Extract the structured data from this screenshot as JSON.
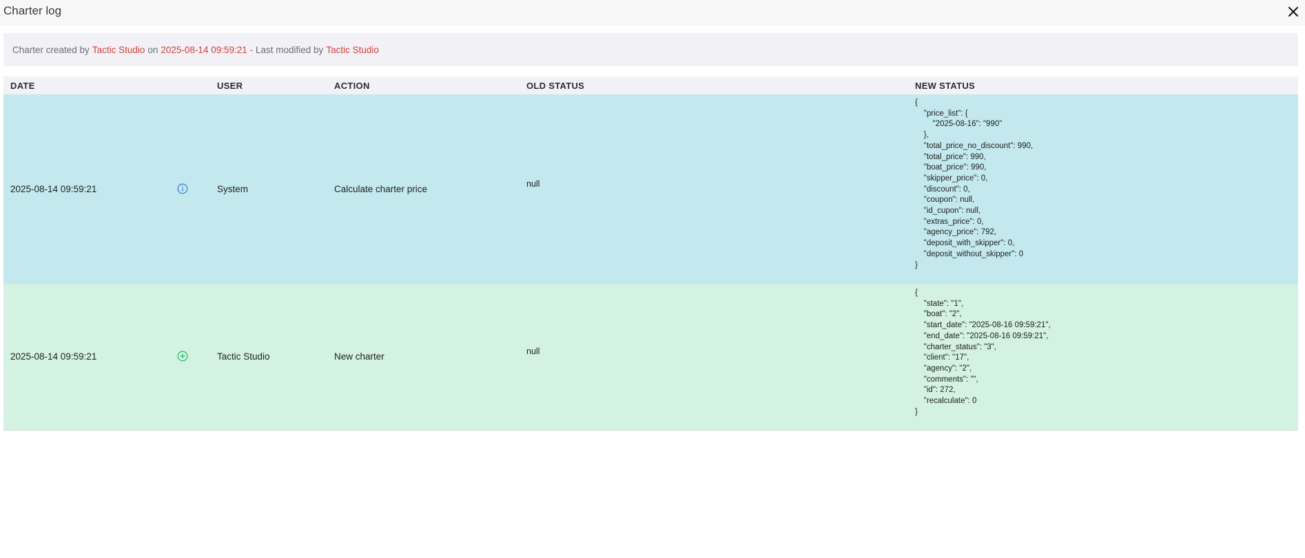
{
  "header": {
    "title": "Charter log"
  },
  "info": {
    "created_by_prefix": "Charter created by",
    "created_by": "Tactic Studio",
    "on_text": "on",
    "created_at": "2025-08-14 09:59:21",
    "modified_text": "- Last modified by",
    "modified_by": "Tactic Studio"
  },
  "table": {
    "columns": [
      "DATE",
      "USER",
      "ACTION",
      "OLD STATUS",
      "NEW STATUS"
    ],
    "rows": [
      {
        "date": "2025-08-14 09:59:21",
        "icon": "info-icon",
        "user": "System",
        "action": "Calculate charter price",
        "old_status": "null",
        "new_status": "{\n    \"price_list\": {\n        \"2025-08-16\": \"990\"\n    },\n    \"total_price_no_discount\": 990,\n    \"total_price\": 990,\n    \"boat_price\": 990,\n    \"skipper_price\": 0,\n    \"discount\": 0,\n    \"coupon\": null,\n    \"id_cupon\": null,\n    \"extras_price\": 0,\n    \"agency_price\": 792,\n    \"deposit_with_skipper\": 0,\n    \"deposit_without_skipper\": 0\n}"
      },
      {
        "date": "2025-08-14 09:59:21",
        "icon": "plus-circle-icon",
        "user": "Tactic Studio",
        "action": "New charter",
        "old_status": "null",
        "new_status": "{\n    \"state\": \"1\",\n    \"boat\": \"2\",\n    \"start_date\": \"2025-08-16 09:59:21\",\n    \"end_date\": \"2025-08-16 09:59:21\",\n    \"charter_status\": \"3\",\n    \"client\": \"17\",\n    \"agency\": \"2\",\n    \"comments\": \"\",\n    \"id\": 272,\n    \"recalculate\": 0\n}"
      }
    ]
  },
  "colors": {
    "accent_link": "#d6403d",
    "row_info_bg": "#c3e9ef",
    "row_create_bg": "#d3f2e1",
    "info_icon": "#3b86d6",
    "plus_icon": "#2fbf71"
  }
}
